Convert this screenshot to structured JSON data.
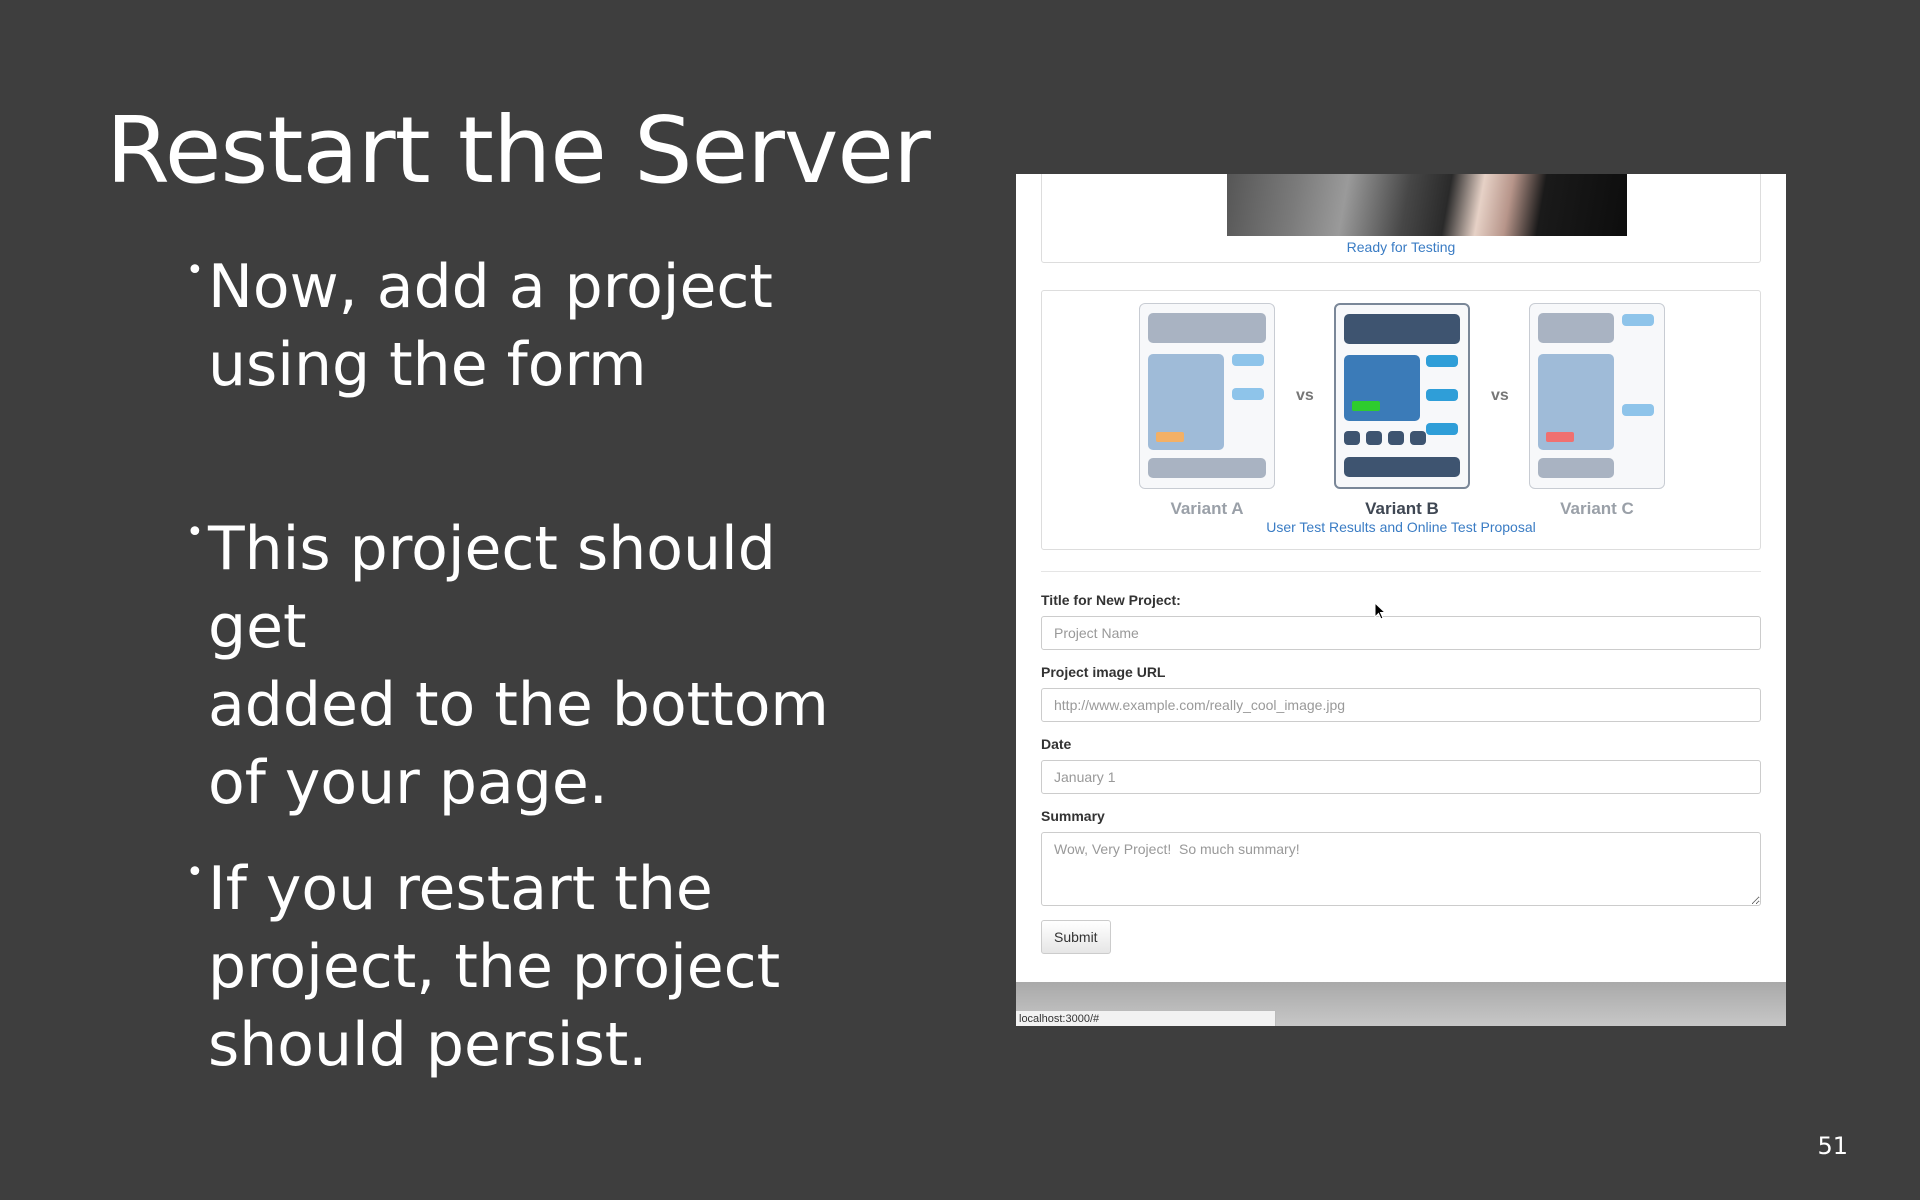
{
  "slide": {
    "title": "Restart the Server",
    "bullets": [
      {
        "lines": [
          "Now, add a project",
          "using the form"
        ]
      },
      {
        "lines": [
          "This project should get",
          "added to the bottom",
          "of your page."
        ]
      },
      {
        "lines": [
          "If you restart the",
          "project, the project",
          "should persist."
        ]
      }
    ],
    "bullet_glyph": "•",
    "page_number": "51"
  },
  "browser": {
    "cards": {
      "photo_caption": "Ready for Testing",
      "variants": [
        {
          "label": "Variant A",
          "accent_color": "#f3b066"
        },
        {
          "label": "Variant B",
          "accent_color": "#2ecc2e"
        },
        {
          "label": "Variant C",
          "accent_color": "#f07070"
        }
      ],
      "vs_label": "vs",
      "variants_caption": "User Test Results and Online Test Proposal"
    },
    "form": {
      "title_label": "Title for New Project:",
      "title_placeholder": "Project Name",
      "image_label": "Project image URL",
      "image_placeholder": "http://www.example.com/really_cool_image.jpg",
      "date_label": "Date",
      "date_placeholder": "January 1",
      "summary_label": "Summary",
      "summary_placeholder": "Wow, Very Project!  So much summary!",
      "submit_label": "Submit"
    },
    "status_bar_url": "localhost:3000/#",
    "link_color": "#3a7cc4"
  }
}
